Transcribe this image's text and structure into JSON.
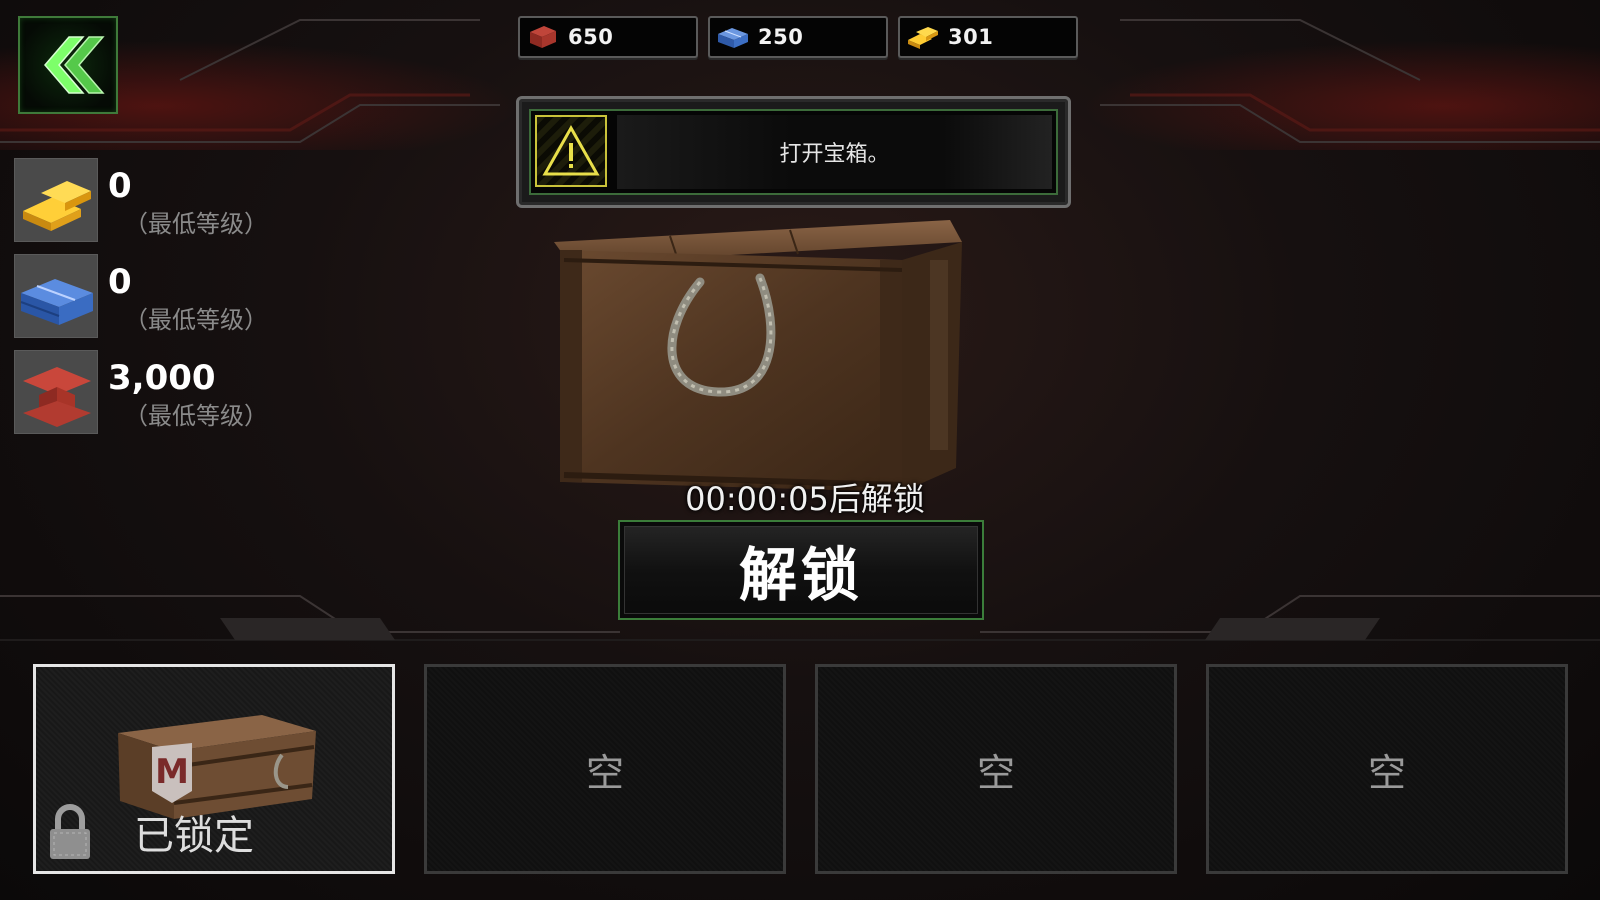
{
  "currencies": [
    {
      "icon": "iron-ingot-icon",
      "value": "650"
    },
    {
      "icon": "blue-blocks-icon",
      "value": "250"
    },
    {
      "icon": "gold-bars-icon",
      "value": "301"
    }
  ],
  "banner": {
    "icon": "warning-icon",
    "message": "打开宝箱。"
  },
  "rewards": [
    {
      "icon": "gold-bars-icon",
      "value": "0",
      "sub": "（最低等级）"
    },
    {
      "icon": "blue-blocks-icon",
      "value": "0",
      "sub": "（最低等级）"
    },
    {
      "icon": "iron-ingot-icon",
      "value": "3,000",
      "sub": "（最低等级）"
    }
  ],
  "timer": "00:00:05后解锁",
  "unlock_label": "解锁",
  "slots": [
    {
      "state": "locked",
      "label": "已锁定"
    },
    {
      "state": "empty",
      "label": "空"
    },
    {
      "state": "empty",
      "label": "空"
    },
    {
      "state": "empty",
      "label": "空"
    }
  ],
  "colors": {
    "accent_green": "#3f7a3a",
    "warning_yellow": "#c9c23a"
  }
}
